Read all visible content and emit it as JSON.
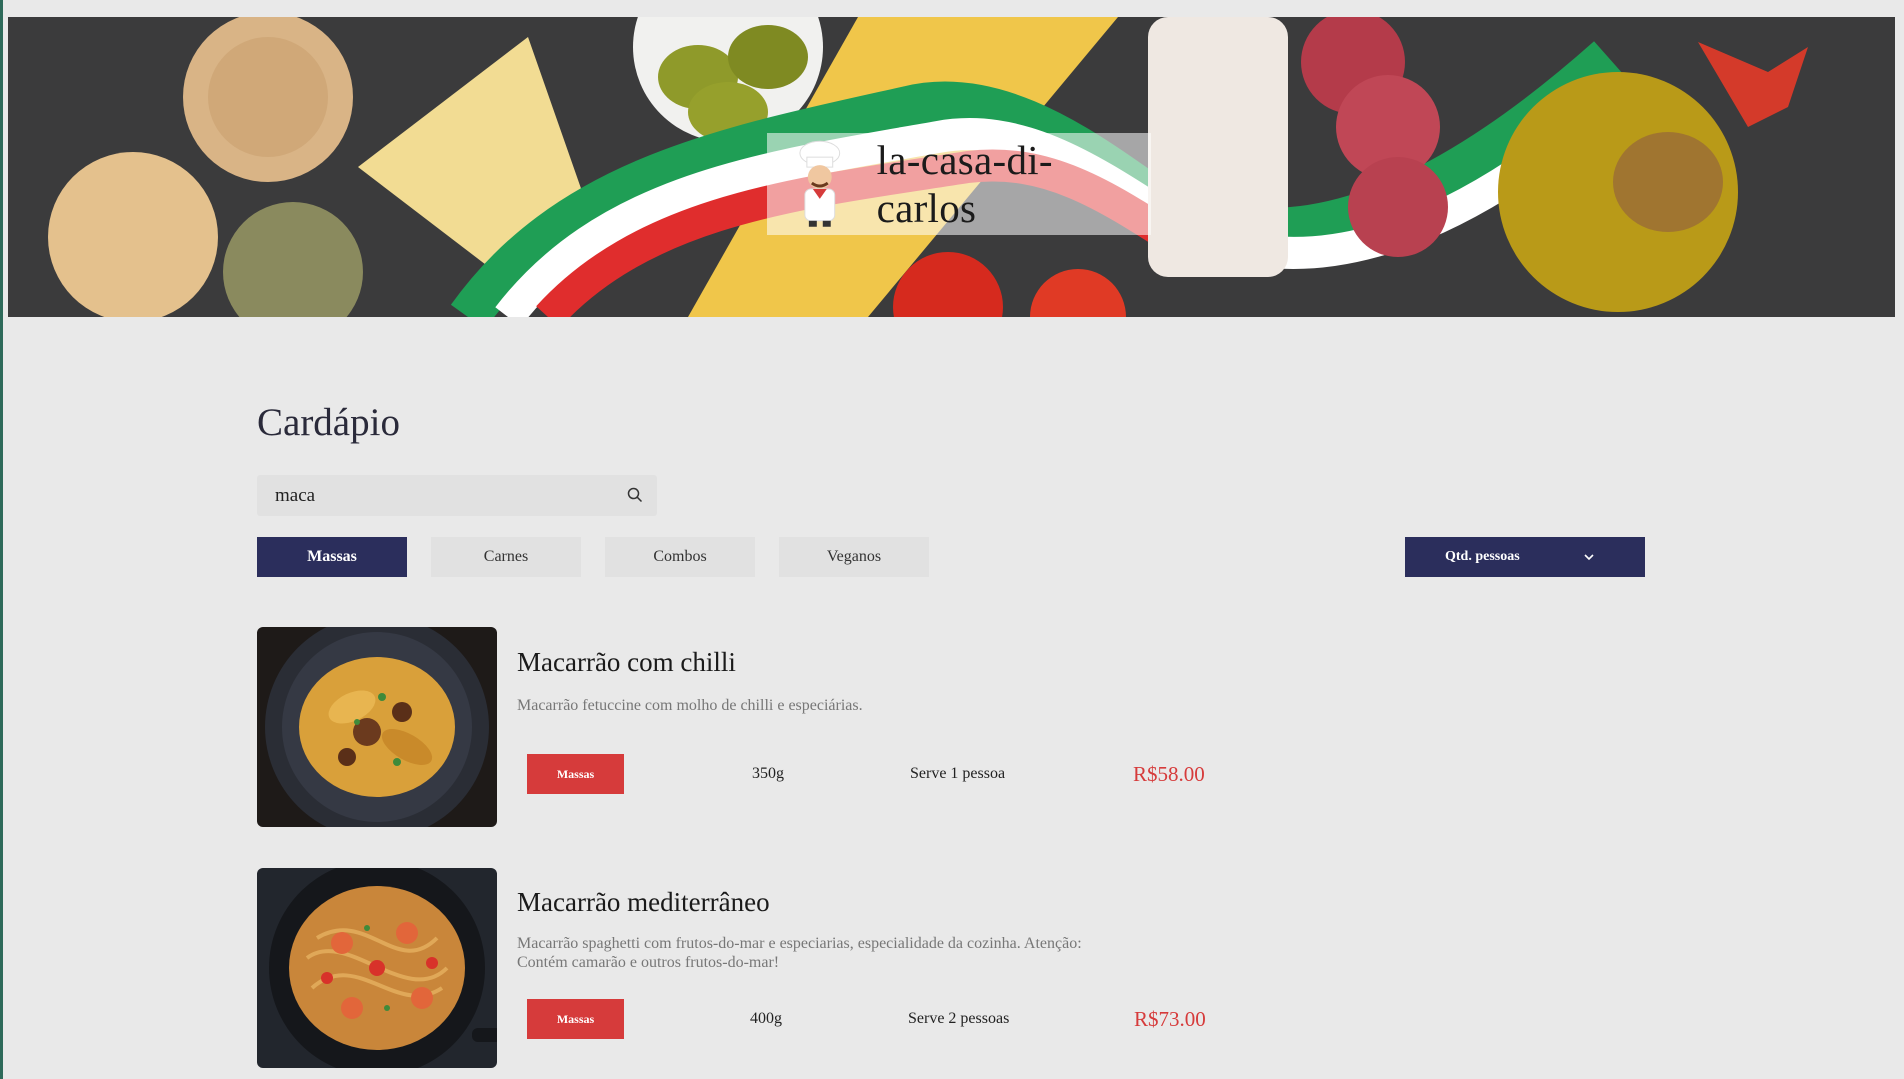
{
  "brand": {
    "name": "la-casa-di-carlos"
  },
  "page": {
    "title": "Cardápio"
  },
  "search": {
    "value": "maca"
  },
  "filters": [
    {
      "label": "Massas",
      "active": true
    },
    {
      "label": "Carnes",
      "active": false
    },
    {
      "label": "Combos",
      "active": false
    },
    {
      "label": "Veganos",
      "active": false
    }
  ],
  "select": {
    "label": "Qtd. pessoas"
  },
  "items": [
    {
      "name": "Macarrão com chilli",
      "description": "Macarrão fetuccine com molho de chilli e especiárias.",
      "category": "Massas",
      "weight": "350g",
      "serves": "Serve 1 pessoa",
      "price": "R$58.00"
    },
    {
      "name": "Macarrão mediterrâneo",
      "description": "Macarrão spaghetti com frutos-do-mar e especiarias, especialidade da cozinha. Atenção: Contém camarão e outros frutos-do-mar!",
      "category": "Massas",
      "weight": "400g",
      "serves": "Serve 2 pessoas",
      "price": "R$73.00"
    }
  ],
  "colors": {
    "primary": "#2b2e5c",
    "accent": "#d63b3b",
    "background": "#e9e9e9"
  },
  "icons": {
    "search": "search-icon",
    "dropdown": "chevron-down-icon",
    "logo": "chef-icon"
  }
}
